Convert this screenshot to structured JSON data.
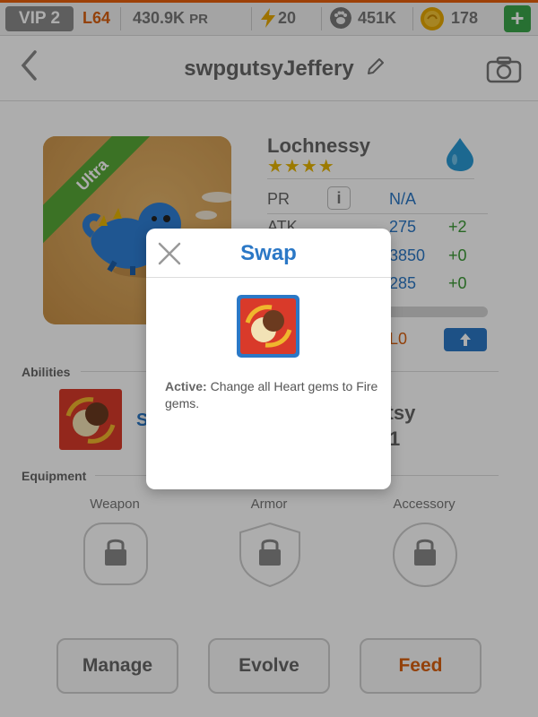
{
  "topbar": {
    "vip": "VIP 2",
    "level": "L64",
    "pr_total_value": "430.9K",
    "pr_total_unit": "PR",
    "energy": "20",
    "paws": "451K",
    "coins": "178",
    "add": "+",
    "icons": [
      "lightning-icon",
      "paw-icon",
      "coin-icon",
      "plus-icon"
    ]
  },
  "header": {
    "back": "‹",
    "player_name": "swpgutsyJeffery"
  },
  "monster": {
    "rarity": "Ultra",
    "name": "Lochnessy",
    "stars": "★★★★",
    "element": "water",
    "stats": [
      {
        "label": "PR",
        "value": "N/A",
        "bonus": ""
      },
      {
        "label": "ATK",
        "value": "275",
        "bonus": "+2"
      },
      {
        "label": "",
        "value": "3850",
        "bonus": "+0"
      },
      {
        "label": "",
        "value": "285",
        "bonus": "+0"
      }
    ],
    "info": "i",
    "level_fragment": "L0",
    "upgrade": "⬆"
  },
  "sections": {
    "abilities": "Abilities",
    "equipment": "Equipment"
  },
  "ability": {
    "name_fragment": "S",
    "leader_fragment_1": "rtsy",
    "leader_fragment_2": "1"
  },
  "equipment": {
    "weapon": "Weapon",
    "armor": "Armor",
    "accessory": "Accessory"
  },
  "actions": {
    "manage": "Manage",
    "evolve": "Evolve",
    "feed": "Feed"
  },
  "modal": {
    "title": "Swap",
    "desc_prefix": "Active:",
    "desc_text": " Change all Heart gems to Fire gems."
  },
  "colors": {
    "accent_orange": "#d96010",
    "accent_blue": "#2b78c6",
    "bonus_green": "#3b9a35",
    "star_gold": "#e6b400",
    "ribbon_green": "#58a837"
  }
}
